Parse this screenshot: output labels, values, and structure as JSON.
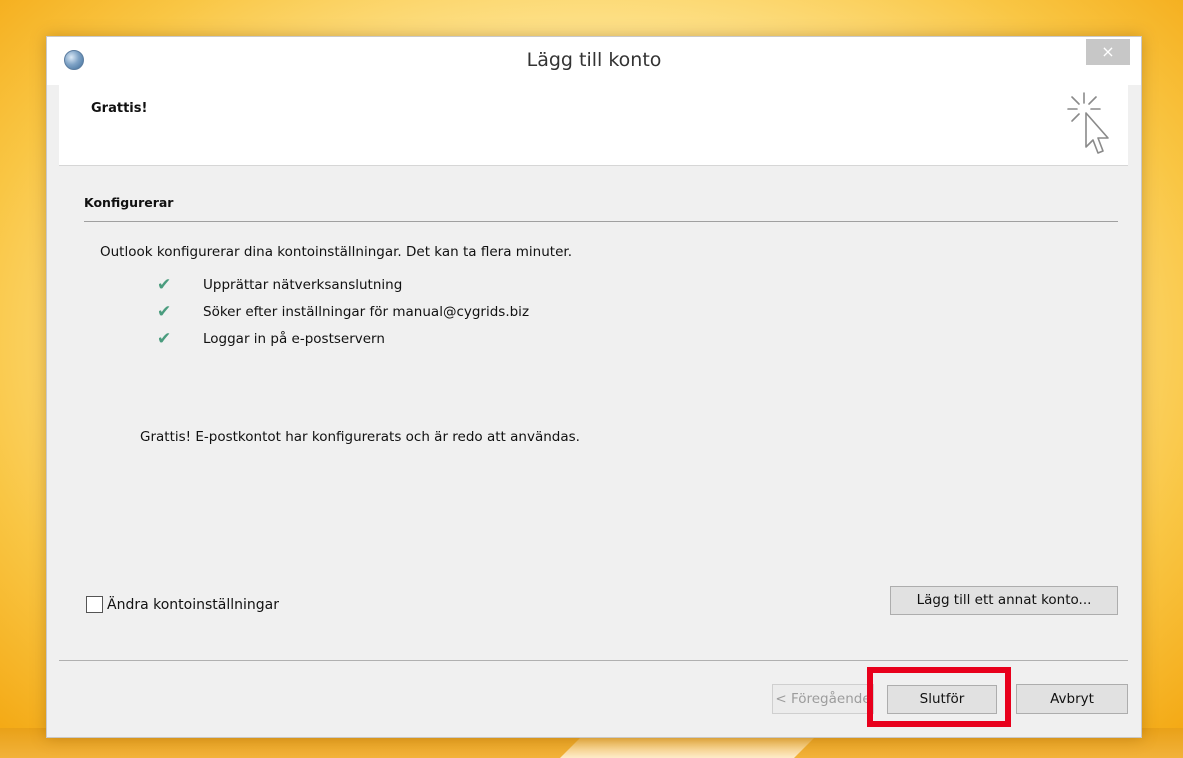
{
  "window": {
    "title": "Lägg till konto",
    "close_label": "×"
  },
  "header": {
    "title": "Grattis!"
  },
  "section": {
    "title": "Konfigurerar",
    "intro": "Outlook konfigurerar dina kontoinställningar. Det kan ta flera minuter."
  },
  "steps": [
    {
      "label": "Upprättar nätverksanslutning",
      "status": "done"
    },
    {
      "label": "Söker efter inställningar för manual@cygrids.biz",
      "status": "done"
    },
    {
      "label": "Loggar in på e-postservern",
      "status": "done"
    }
  ],
  "success_message": "Grattis! E-postkontot har konfigurerats och är redo att användas.",
  "options": {
    "change_settings_label": "Ändra kontoinställningar",
    "change_settings_checked": false
  },
  "buttons": {
    "add_another": "Lägg till ett annat konto...",
    "previous": "< Föregående",
    "finish": "Slutför",
    "cancel": "Avbryt"
  },
  "colors": {
    "check": "#4a9c7e",
    "highlight": "#e8001c"
  },
  "icons": {
    "app": "outlook-globe-icon",
    "header_graphic": "sparkle-cursor-icon",
    "step_status": "checkmark-icon"
  }
}
